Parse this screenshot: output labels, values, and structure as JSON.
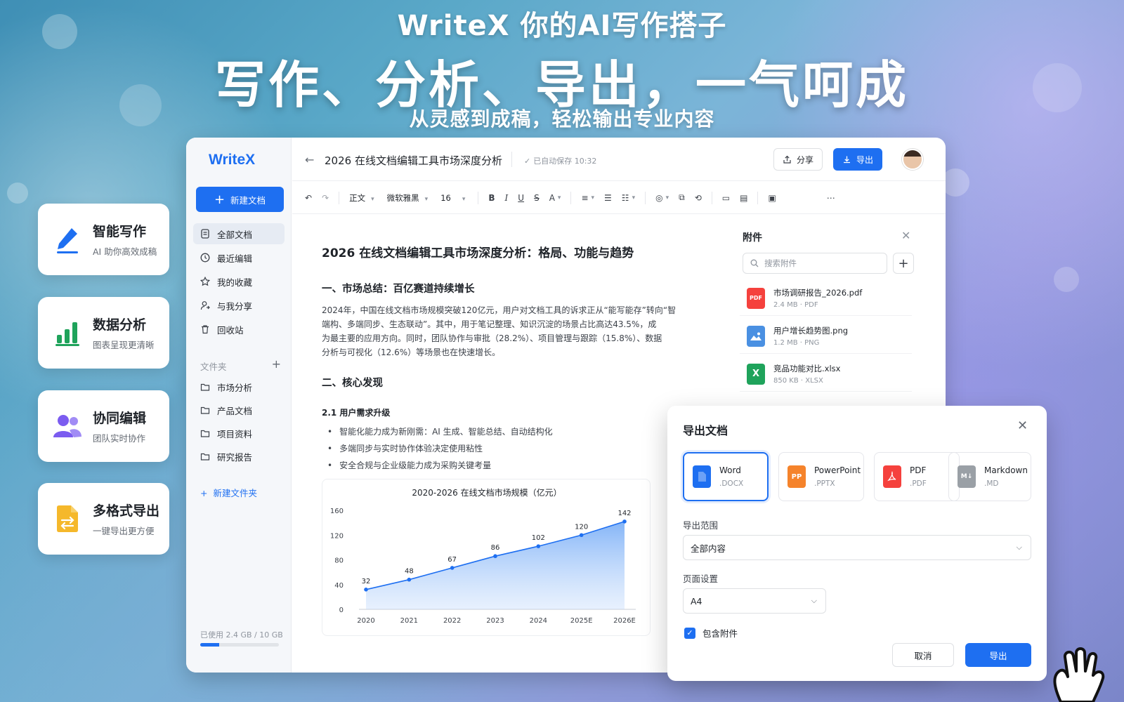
{
  "hero": {
    "tagline": "WriteX 你的AI写作搭子",
    "headline": "写作、分析、导出，一气呵成",
    "subline": "从灵感到成稿，轻松输出专业内容"
  },
  "features": [
    {
      "title": "智能写作",
      "desc": "AI 助你高效成稿"
    },
    {
      "title": "数据分析",
      "desc": "图表呈现更清晰"
    },
    {
      "title": "协同编辑",
      "desc": "团队实时协作"
    },
    {
      "title": "多格式导出",
      "desc": "一键导出更方便"
    }
  ],
  "colors": {
    "accent": "#1e6ff1",
    "pdf": "#f5413d",
    "image": "#4a90e2",
    "excel": "#1fa35b",
    "ppt": "#f5832b",
    "md": "#9aa0a6"
  },
  "sidebar": {
    "logo": "WriteX",
    "new_doc": "新建文档",
    "nav": [
      {
        "label": "全部文档",
        "icon": "doc-icon"
      },
      {
        "label": "最近编辑",
        "icon": "clock-icon"
      },
      {
        "label": "我的收藏",
        "icon": "star-icon"
      },
      {
        "label": "与我分享",
        "icon": "share-user-icon"
      },
      {
        "label": "回收站",
        "icon": "trash-icon"
      }
    ],
    "folders_label": "文件夹",
    "folders": [
      "市场分析",
      "产品文档",
      "项目资料",
      "研究报告"
    ],
    "new_folder": "新建文件夹",
    "storage_text": "已使用 2.4 GB / 10 GB",
    "storage_fraction": 0.24
  },
  "topbar": {
    "title": "2026 在线文档编辑工具市场深度分析",
    "autosave": "已自动保存 10:32",
    "share": "分享",
    "export": "导出"
  },
  "toolbar": {
    "style": "正文",
    "font": "微软雅黑",
    "size": "16"
  },
  "doc": {
    "h1": "2026 在线文档编辑工具市场深度分析：格局、功能与趋势",
    "sec1": "一、市场总结：百亿赛道持续增长",
    "para_lines": [
      "2024年，中国在线文档市场规模突破120亿元，用户对文档工具的诉求正从“能写能存”转向“智",
      "端构、多端同步、生态联动”。其中，用于笔记整理、知识沉淀的场景占比高达43.5%，成",
      "为最主要的应用方向。同时，团队协作与审批（28.2%）、项目管理与跟踪（15.8%）、数据",
      "分析与可视化（12.6%）等场景也在快速增长。"
    ],
    "sec2": "二、核心发现",
    "sub21": "2.1 用户需求升级",
    "bullets": [
      "智能化能力成为新刚需：AI 生成、智能总结、自动结构化",
      "多端同步与实时协作体验决定使用粘性",
      "安全合规与企业级能力成为采购关键考量"
    ]
  },
  "chart_data": {
    "type": "area",
    "title": "2020-2026 在线文档市场规模（亿元）",
    "categories": [
      "2020",
      "2021",
      "2022",
      "2023",
      "2024",
      "2025E",
      "2026E"
    ],
    "values": [
      32,
      48,
      67,
      86,
      102,
      120,
      142
    ],
    "yticks": [
      0,
      40,
      80,
      120,
      160
    ],
    "ylim": [
      0,
      160
    ],
    "grid": false
  },
  "attachments": {
    "title": "附件",
    "search_placeholder": "搜索附件",
    "files": [
      {
        "name": "市场调研报告_2026.pdf",
        "meta": "2.4 MB · PDF",
        "badge": "PDF",
        "kind": "pdf"
      },
      {
        "name": "用户增长趋势图.png",
        "meta": "1.2 MB · PNG",
        "badge": "",
        "kind": "image"
      },
      {
        "name": "竞品功能对比.xlsx",
        "meta": "850 KB · XLSX",
        "badge": "X",
        "kind": "excel"
      }
    ]
  },
  "export_dialog": {
    "title": "导出文档",
    "formats": [
      {
        "name": "Word",
        "ext": ".DOCX",
        "badge": "",
        "selected": true
      },
      {
        "name": "PowerPoint",
        "ext": ".PPTX",
        "badge": "PP",
        "selected": false
      },
      {
        "name": "PDF",
        "ext": ".PDF",
        "badge": "",
        "selected": false
      },
      {
        "name": "Markdown",
        "ext": ".MD",
        "badge": "M↓",
        "selected": false
      }
    ],
    "range_label": "导出范围",
    "range_value": "全部内容",
    "page_label": "页面设置",
    "page_value": "A4",
    "include_attachments": "包含附件",
    "include_checked": true,
    "cancel": "取消",
    "export": "导出"
  }
}
